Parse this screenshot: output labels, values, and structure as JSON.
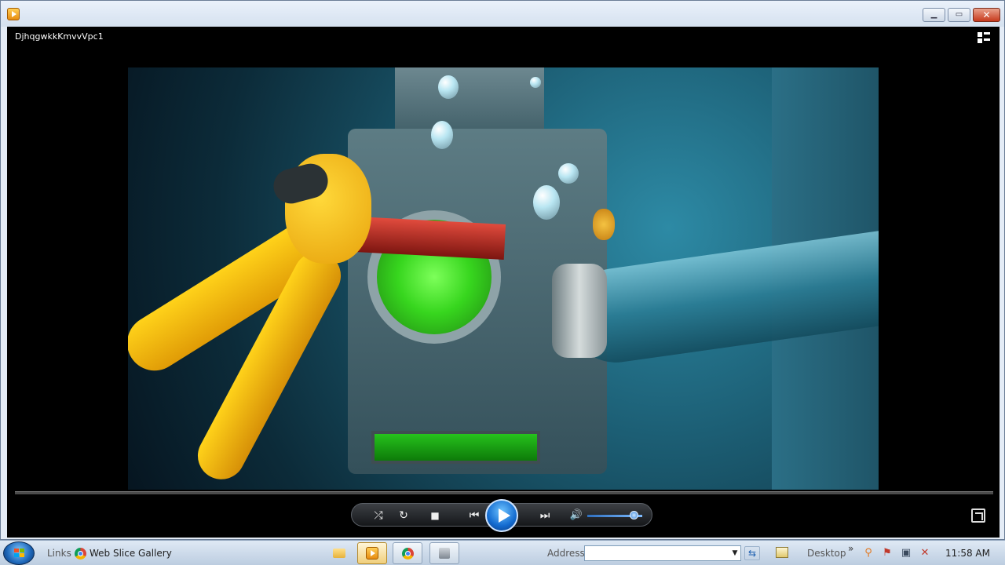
{
  "window": {
    "minimize_glyph": "▁",
    "maximize_glyph": "▭",
    "close_glyph": "✕"
  },
  "player": {
    "media_title": "DjhqgwkkKmvvVpc1",
    "controls": {
      "shuffle_glyph": "⤮",
      "repeat_glyph": "↻",
      "stop_glyph": "■",
      "previous_glyph": "⏮",
      "next_glyph": "⏭",
      "volume_glyph": "🔊",
      "volume_level": 0.85
    }
  },
  "taskbar": {
    "links_label": "Links",
    "web_slice_label": "Web Slice Gallery",
    "address_label": "Address",
    "address_value": "",
    "address_dropdown_glyph": "▼",
    "go_glyph": "⇆",
    "desktop_label": "Desktop",
    "chevron": "»",
    "clock": "11:58 AM"
  },
  "icons": {
    "app": "windows-media-player-icon",
    "start": "windows-start-orb",
    "explorer": "folder-icon",
    "chrome": "chrome-icon",
    "media_player_task": "media-player-icon",
    "network": "network-icon",
    "volume_muted": "volume-muted-icon"
  }
}
